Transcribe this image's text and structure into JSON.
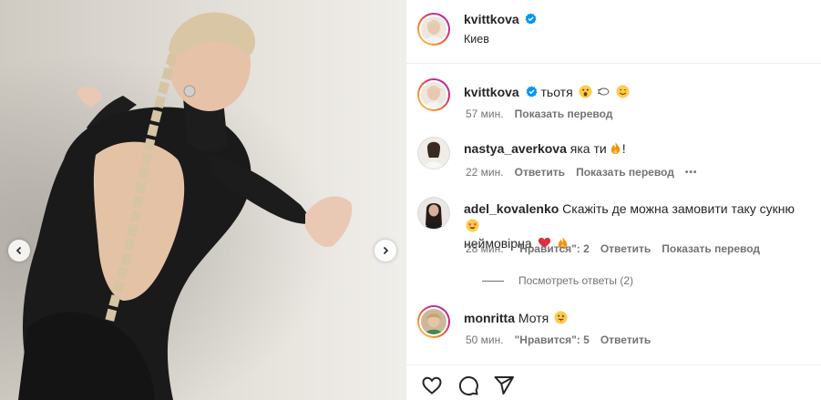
{
  "post": {
    "author": "kvittkova",
    "location": "Киев"
  },
  "caption": {
    "username": "kvittkova",
    "text": "тьотя",
    "emojis": [
      "face-with-open-mouth-emoji",
      "dashing-away-emoji",
      "smiling-face-emoji"
    ],
    "time": "57 мин.",
    "translate": "Показать перевод"
  },
  "comments": [
    {
      "username": "nastya_averkova",
      "text": "яка ти",
      "text_suffix": "!",
      "emojis": [
        "fire-emoji"
      ],
      "time": "22 мин.",
      "reply": "Ответить",
      "translate": "Показать перевод",
      "more": "•••"
    },
    {
      "username": "adel_kovalenko",
      "text": "Скажіть де можна замовити таку сукню",
      "text_line2": "неймовірна",
      "emojis": [
        "star-struck-emoji",
        "red-heart-emoji",
        "fire-emoji"
      ],
      "time": "28 мин.",
      "likes": "\"Нравится\": 2",
      "reply": "Ответить",
      "translate": "Показать перевод",
      "view_replies": "Посмотреть ответы (2)"
    },
    {
      "username": "monritta",
      "text": "Мотя",
      "emojis": [
        "tongue-out-emoji"
      ],
      "time": "50 мин.",
      "likes": "\"Нравится\": 5",
      "reply": "Ответить"
    }
  ],
  "colors": {
    "verified": "#0095f6",
    "secondary_text": "#737373",
    "divider": "#efefef"
  }
}
